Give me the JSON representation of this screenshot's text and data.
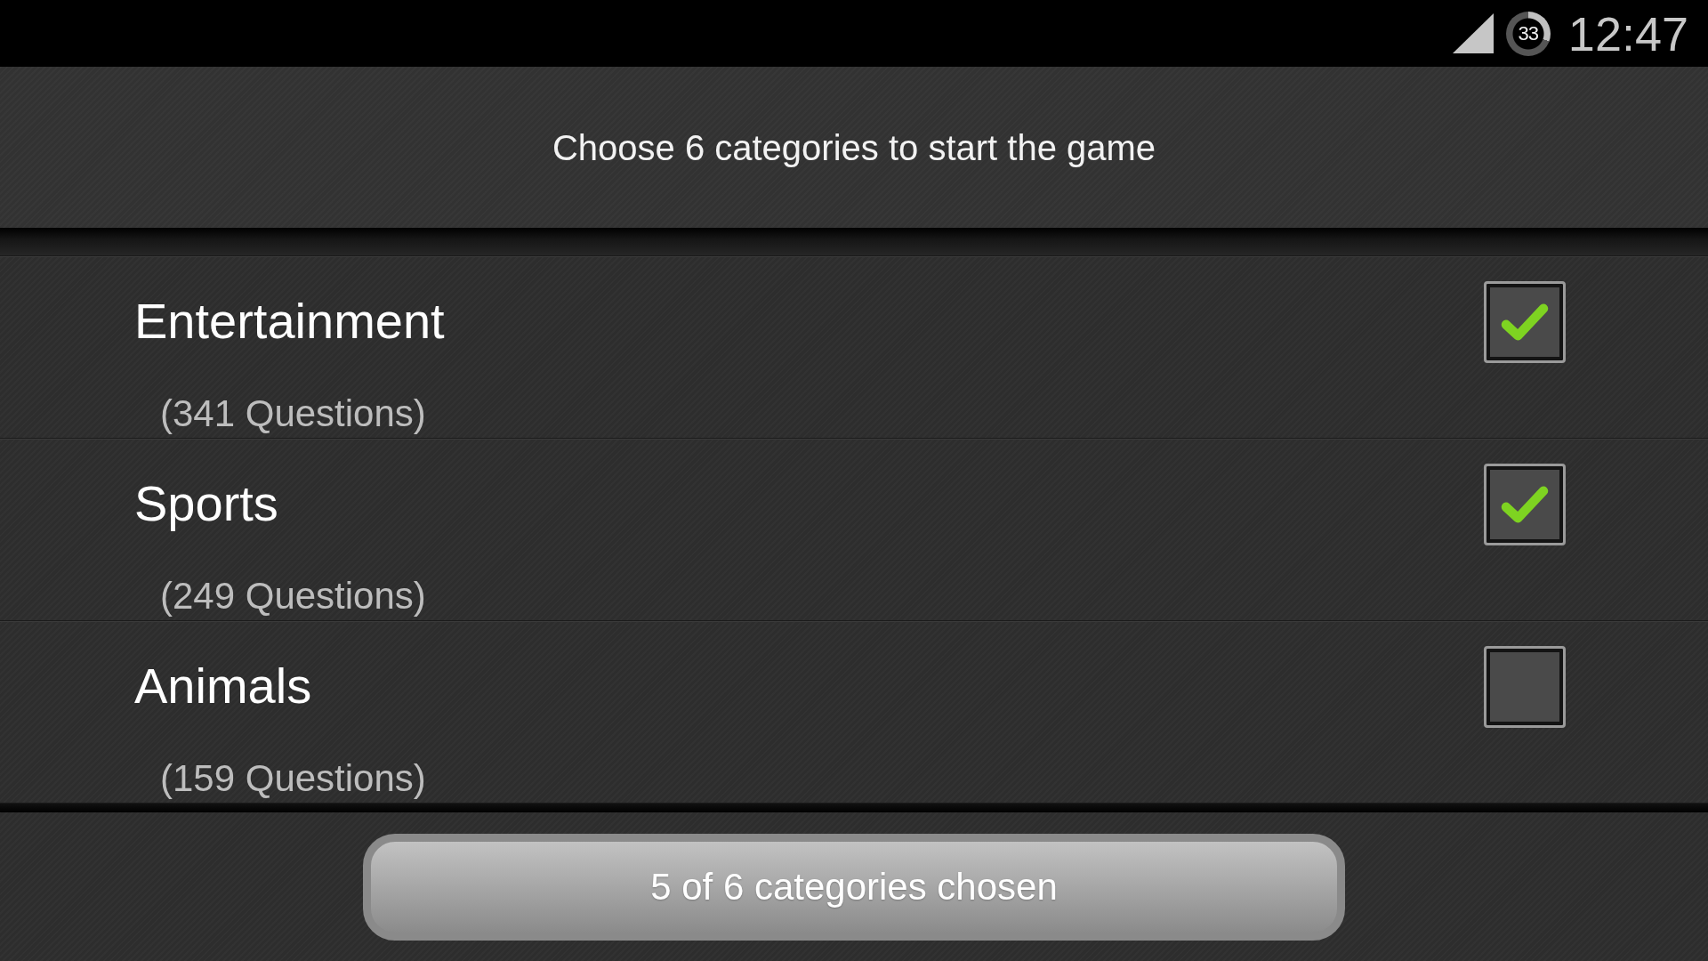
{
  "status_bar": {
    "timer_badge": "33",
    "time": "12:47"
  },
  "header": {
    "title": "Choose 6 categories to start the game"
  },
  "categories": [
    {
      "name": "Entertainment",
      "count": "(341 Questions)",
      "checked": true
    },
    {
      "name": "Sports",
      "count": "(249 Questions)",
      "checked": true
    },
    {
      "name": "Animals",
      "count": "(159 Questions)",
      "checked": false
    }
  ],
  "footer": {
    "button_label": "5 of 6 categories chosen"
  }
}
